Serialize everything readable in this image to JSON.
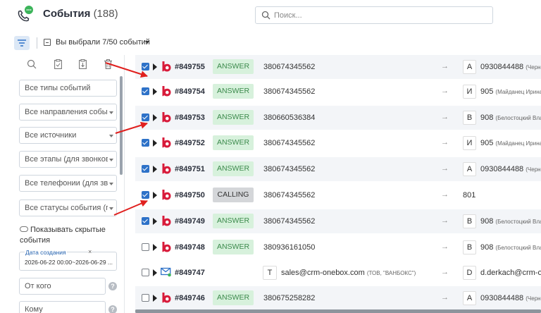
{
  "header": {
    "title": "События",
    "count": "(188)",
    "search_placeholder": "Поиск..."
  },
  "toolbar": {
    "selection_text": "Вы выбрали 7/50 событий"
  },
  "sidebar": {
    "fields": [
      {
        "label": "Все типы событий",
        "dropdown": false
      },
      {
        "label": "Все направления событ...",
        "dropdown": true
      },
      {
        "label": "Все источники",
        "dropdown": true
      },
      {
        "label": "Все этапы (для звонков)...",
        "dropdown": true
      },
      {
        "label": "Все телефонии (для зво...",
        "dropdown": true
      },
      {
        "label": "Все статусы события (пр...",
        "dropdown": true
      }
    ],
    "toggle_label": "Показывать скрытые события",
    "date_filter": {
      "label": "Дата создания",
      "value": "2026-06-22 00:00~2026-06-29 ..."
    },
    "from_placeholder": "От кого",
    "to_placeholder": "Кому"
  },
  "rows": [
    {
      "checked": true,
      "icon": "b-logo-icon",
      "id": "#849755",
      "status": "ANSWER",
      "source": "380674345562",
      "badge": "А",
      "target": "0930844488",
      "target_note": "(Черне"
    },
    {
      "checked": true,
      "icon": "b-logo-icon",
      "id": "#849754",
      "status": "ANSWER",
      "source": "380674345562",
      "badge": "И",
      "target": "905",
      "target_note": "(Майданец Ирина"
    },
    {
      "checked": true,
      "icon": "b-logo-icon",
      "id": "#849753",
      "status": "ANSWER",
      "source": "380660536384",
      "badge": "В",
      "target": "908",
      "target_note": "(Белоcтоцкий Вла"
    },
    {
      "checked": true,
      "icon": "b-logo-icon",
      "id": "#849752",
      "status": "ANSWER",
      "source": "380674345562",
      "badge": "И",
      "target": "905",
      "target_note": "(Майданец Ирина"
    },
    {
      "checked": true,
      "icon": "b-logo-icon",
      "id": "#849751",
      "status": "ANSWER",
      "source": "380674345562",
      "badge": "А",
      "target": "0930844488",
      "target_note": "(Черне"
    },
    {
      "checked": true,
      "icon": "b-logo-icon",
      "id": "#849750",
      "status": "CALLING",
      "source": "380674345562",
      "badge": "",
      "target": "801",
      "target_note": ""
    },
    {
      "checked": true,
      "icon": "b-logo-icon",
      "id": "#849749",
      "status": "ANSWER",
      "source": "380674345562",
      "badge": "В",
      "target": "908",
      "target_note": "(Белоcтоцкий Вла"
    },
    {
      "checked": false,
      "icon": "b-logo-icon",
      "id": "#849748",
      "status": "ANSWER",
      "source": "380936161050",
      "badge": "В",
      "target": "908",
      "target_note": "(Белоcтоцкий Вла"
    },
    {
      "checked": false,
      "icon": "mail-icon",
      "id": "#849747",
      "status": "",
      "source_badge": "T",
      "source": "sales@crm-onebox.com",
      "source_note": "(ТОВ, \"ВАНБОКС\")",
      "badge": "D",
      "target": "d.derkach@crm-one",
      "target_note": ""
    },
    {
      "checked": false,
      "icon": "b-logo-icon",
      "id": "#849746",
      "status": "ANSWER",
      "source": "380675258282",
      "badge": "А",
      "target": "0930844488",
      "target_note": "(Черне"
    }
  ],
  "colors": {
    "accent": "#2e72c8",
    "answer_bg": "#d7f1dc",
    "answer_text": "#3c8a4c",
    "annotation_arrow": "#e0201e"
  }
}
